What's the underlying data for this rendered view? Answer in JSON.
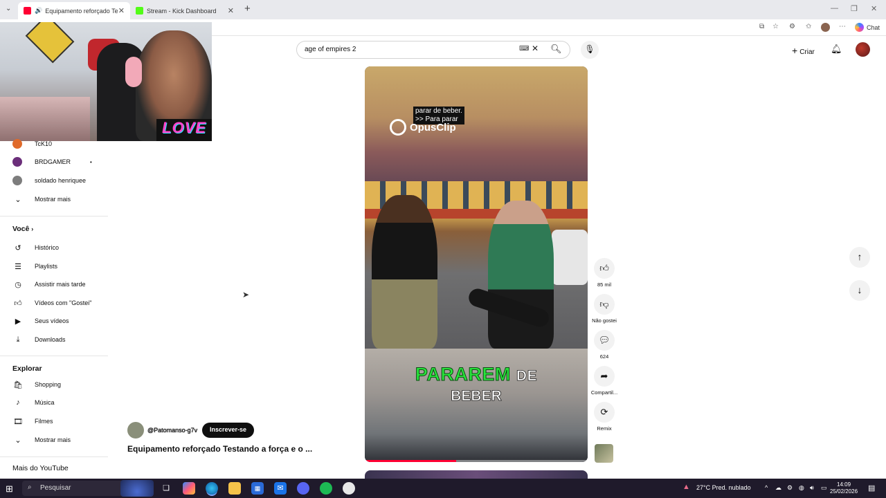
{
  "browser": {
    "tabs": [
      {
        "title": "Equipamento reforçado  Testa",
        "active": true
      },
      {
        "title": "Stream - Kick Dashboard",
        "active": false
      }
    ],
    "new_tab": "+",
    "chat_label": "Chat"
  },
  "webcam": {
    "overlay_text": "LOVE"
  },
  "header": {
    "search_value": "age of empires 2",
    "create_label": "Criar"
  },
  "sidebar": {
    "channels": [
      {
        "name": "TcK10"
      },
      {
        "name": "BRDGAMER",
        "dot": "•"
      },
      {
        "name": "soldado henriquee"
      }
    ],
    "show_more_1": "Mostrar mais",
    "you_heading": "Você",
    "you_items": [
      "Histórico",
      "Playlists",
      "Assistir mais tarde",
      "Vídeos com \"Gostei\"",
      "Seus vídeos",
      "Downloads"
    ],
    "explore_heading": "Explorar",
    "explore_items": [
      "Shopping",
      "Música",
      "Filmes"
    ],
    "show_more_2": "Mostrar mais",
    "more_heading": "Mais do YouTube"
  },
  "video": {
    "subtitle_line1": "parar de beber.",
    "subtitle_line2": ">> Para parar",
    "watermark": "OpusClip",
    "caption_green": "PARAREM",
    "caption_white": "DE",
    "caption_line2": "BEBER",
    "progress": 0.41,
    "channel_handle": "@Patomanso-g7v",
    "subscribe_label": "Inscrever-se",
    "title": "Equipamento reforçado  Testando a força e o ..."
  },
  "actions": {
    "like_count": "85 mil",
    "dislike_label": "Não gostei",
    "comment_count": "624",
    "share_label": "Compartil...",
    "remix_label": "Remix"
  },
  "taskbar": {
    "search_placeholder": "Pesquisar",
    "weather": "27°C  Pred. nublado",
    "time": "14:09",
    "date": "25/02/2026"
  },
  "colors": {
    "accent_red": "#ff0033",
    "caption_green": "#29e33c",
    "taskbar_bg": "#1f1a2b"
  }
}
